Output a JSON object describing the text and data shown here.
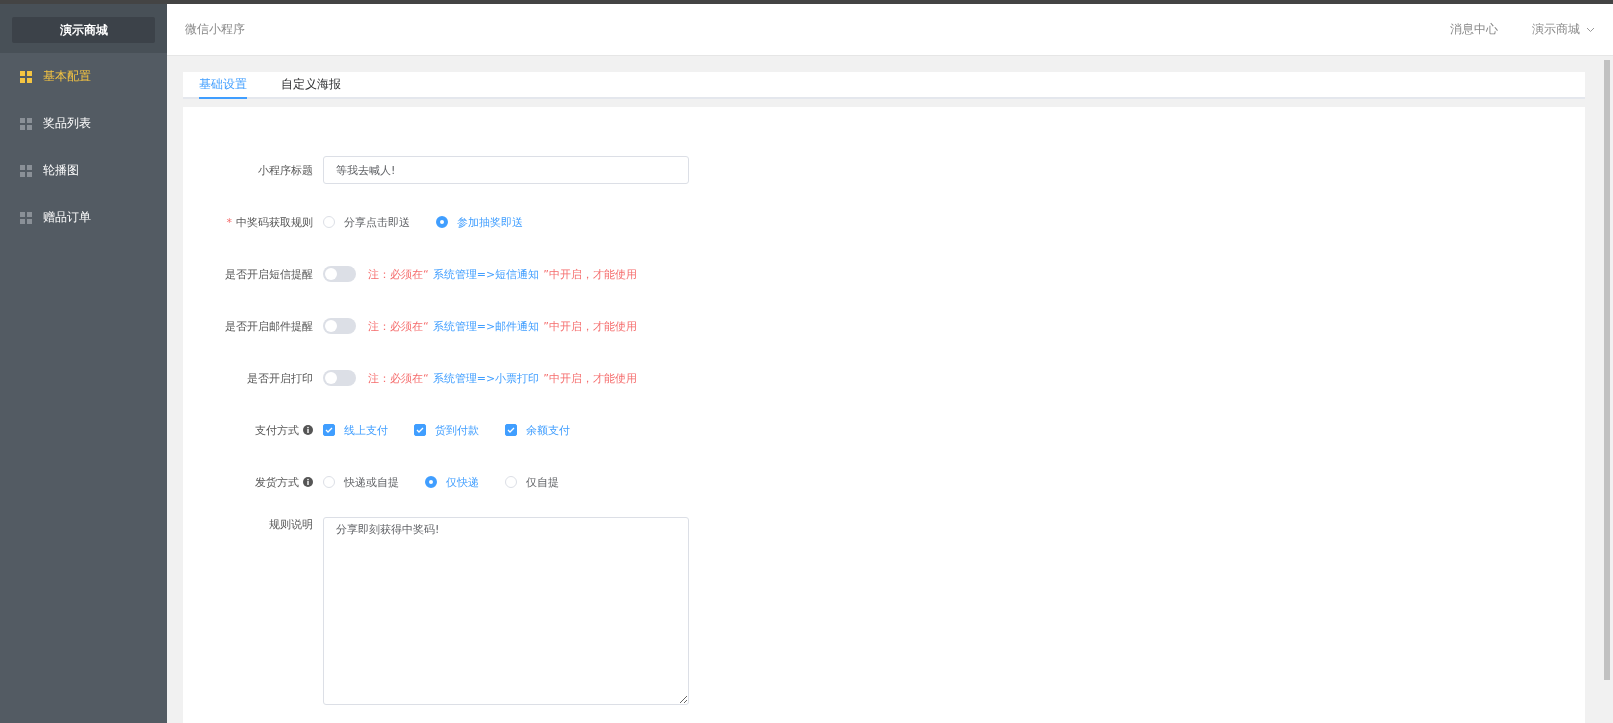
{
  "sidebar": {
    "brand": "演示商城",
    "items": [
      {
        "label": "基本配置",
        "selected": true
      },
      {
        "label": "奖品列表",
        "selected": false
      },
      {
        "label": "轮播图",
        "selected": false
      },
      {
        "label": "赠品订单",
        "selected": false
      }
    ]
  },
  "header": {
    "title": "微信小程序",
    "links": [
      "消息中心"
    ],
    "account": "演示商城"
  },
  "tabs": [
    {
      "label": "基础设置",
      "selected": true
    },
    {
      "label": "自定义海报",
      "selected": false
    }
  ],
  "form": [
    {
      "kind": "input",
      "label": "小程序标题",
      "value": "等我去喊人!"
    },
    {
      "kind": "radio",
      "label": "中奖码获取规则",
      "required_mark": "*",
      "options": [
        {
          "label": "分享点击即送",
          "selected": false
        },
        {
          "label": "参加抽奖即送",
          "selected": true
        }
      ]
    },
    {
      "kind": "switch",
      "label": "是否开启短信提醒",
      "on": false,
      "note": {
        "prefix": "注：必须在“",
        "path": "系统管理=>短信通知",
        "suffix": "”中开启，才能使用"
      }
    },
    {
      "kind": "switch",
      "label": "是否开启邮件提醒",
      "on": false,
      "note": {
        "prefix": "注：必须在“",
        "path": "系统管理=>邮件通知",
        "suffix": "”中开启，才能使用"
      }
    },
    {
      "kind": "switch",
      "label": "是否开启打印",
      "on": false,
      "note": {
        "prefix": "注：必须在“",
        "path": "系统管理=>小票打印",
        "suffix": "”中开启，才能使用"
      }
    },
    {
      "kind": "checkbox",
      "label": "支付方式",
      "info": true,
      "options": [
        {
          "label": "线上支付",
          "checked": true
        },
        {
          "label": "货到付款",
          "checked": true
        },
        {
          "label": "余额支付",
          "checked": true
        }
      ]
    },
    {
      "kind": "radio",
      "label": "发货方式",
      "info": true,
      "options": [
        {
          "label": "快递或自提",
          "selected": false
        },
        {
          "label": "仅快递",
          "selected": true
        },
        {
          "label": "仅自提",
          "selected": false
        }
      ]
    },
    {
      "kind": "textarea",
      "label": "规则说明",
      "value": "分享即刻获得中奖码!"
    }
  ]
}
